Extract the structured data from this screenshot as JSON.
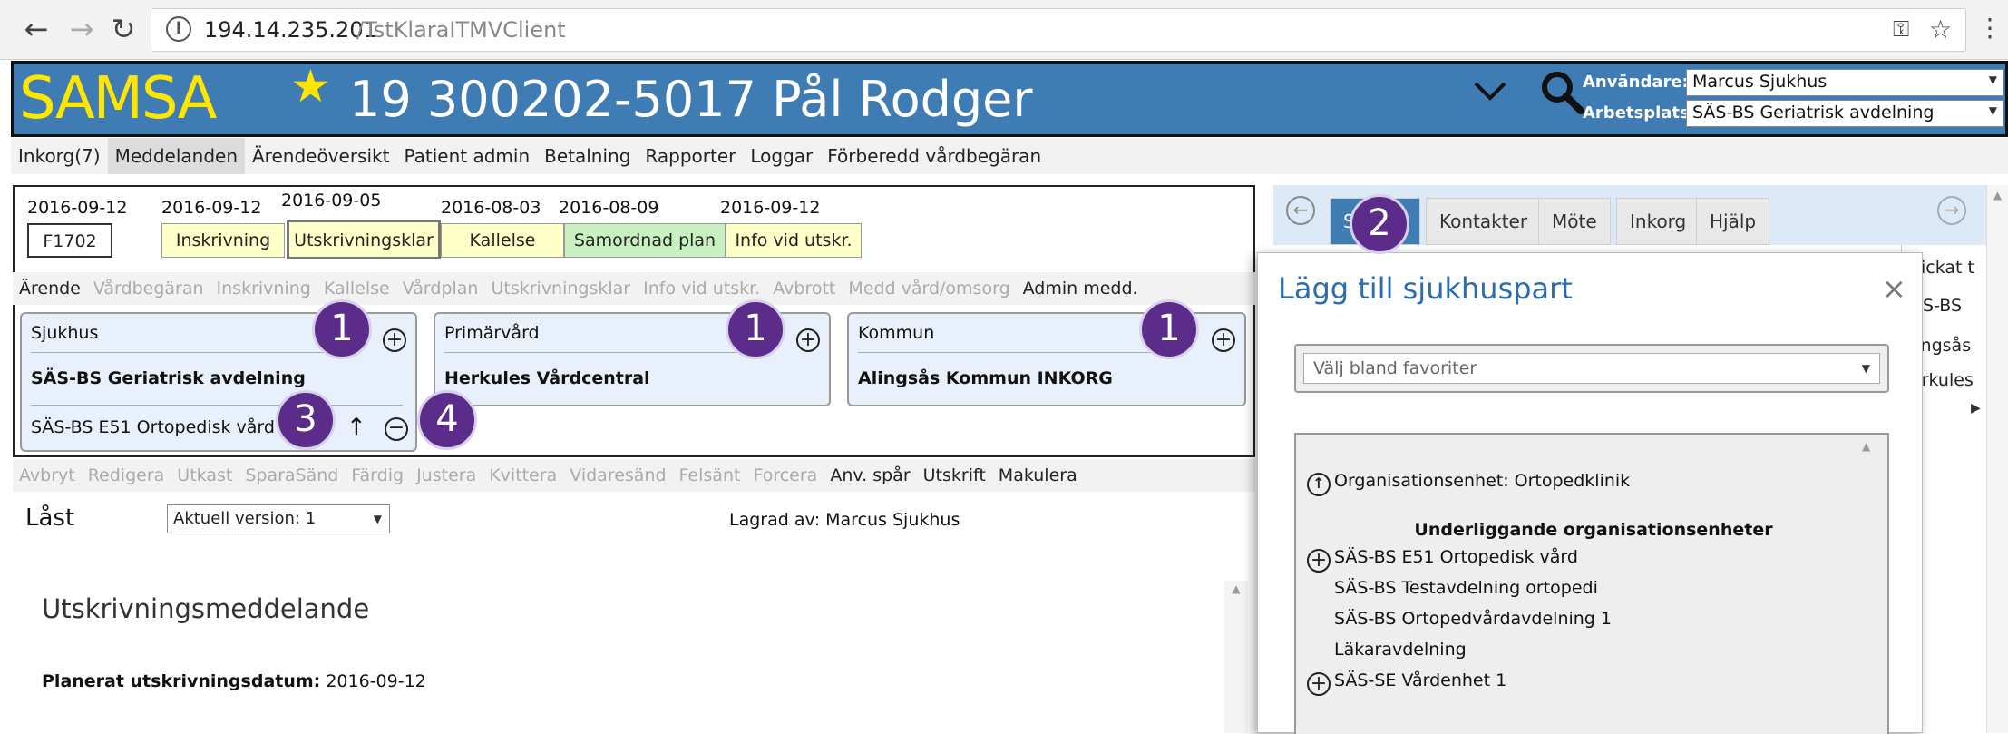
{
  "browser": {
    "url_host": "194.14.235.201",
    "url_path": "/TstKlaraITMVClient"
  },
  "header": {
    "logo": "SAMSA",
    "patient": "19 300202-5017 Pål Rodger",
    "user_label": "Användare:",
    "user_value": "Marcus Sjukhus",
    "workplace_label": "Arbetsplats:",
    "workplace_value": "SÄS-BS Geriatrisk avdelning"
  },
  "main_menu": [
    "Inkorg(7)",
    "Meddelanden",
    "Ärendeöversikt",
    "Patient admin",
    "Betalning",
    "Rapporter",
    "Loggar",
    "Förberedd vårdbegäran"
  ],
  "timeline": {
    "case_date": "2016-09-12",
    "case_id": "F1702",
    "stages": [
      {
        "date": "2016-09-12",
        "label": "Inskrivning",
        "color": "#ffffc8"
      },
      {
        "date": "2016-09-05",
        "label": "Utskrivningsklar",
        "color": "#ffffc8"
      },
      {
        "date": "2016-08-03",
        "label": "Kallelse",
        "color": "#ffffc8"
      },
      {
        "date": "2016-08-09",
        "label": "Samordnad plan",
        "color": "#c8f0c0"
      },
      {
        "date": "2016-09-12",
        "label": "Info vid utskr.",
        "color": "#ffffc8"
      }
    ]
  },
  "sub_menu": [
    "Ärende",
    "Vårdbegäran",
    "Inskrivning",
    "Kallelse",
    "Vårdplan",
    "Utskrivningsklar",
    "Info vid utskr.",
    "Avbrott",
    "Medd vård/omsorg",
    "Admin medd."
  ],
  "parties": [
    {
      "title": "Sjukhus",
      "unit": "SÄS-BS Geriatrisk avdelning",
      "extra": "SÄS-BS E51 Ortopedisk vård"
    },
    {
      "title": "Primärvård",
      "unit": "Herkules Vårdcentral"
    },
    {
      "title": "Kommun",
      "unit": "Alingsås Kommun INKORG"
    }
  ],
  "callouts": [
    "1",
    "1",
    "1",
    "2",
    "3",
    "4"
  ],
  "actions": [
    "Avbryt",
    "Redigera",
    "Utkast",
    "SparaSänd",
    "Färdig",
    "Justera",
    "Kvittera",
    "Vidaresänd",
    "Felsänt",
    "Forcera",
    "Anv. spår",
    "Utskrift",
    "Makulera"
  ],
  "status": {
    "state": "Låst",
    "version": "Aktuell version: 1",
    "saved_by": "Lagrad av: Marcus Sjukhus"
  },
  "content": {
    "heading": "Utskrivningsmeddelande",
    "planned_label": "Planerat utskrivningsdatum:",
    "planned_value": "2016-09-12"
  },
  "right_tabs": [
    "S",
    "Kontakter",
    "Möte",
    "Inkorg",
    "Hjälp"
  ],
  "right_table": [
    "kickat t",
    "ÄS-BS",
    "lingsås",
    "erkules"
  ],
  "modal": {
    "title": "Lägg till sjukhuspart",
    "favorites_placeholder": "Välj bland favoriter",
    "org_unit": "Organisationsenhet: Ortopedklinik",
    "sub_heading": "Underliggande organisationsenheter",
    "units": [
      {
        "label": "SÄS-BS E51 Ortopedisk vård",
        "expandable": true
      },
      {
        "label": "SÄS-BS Testavdelning ortopedi",
        "expandable": false
      },
      {
        "label": "SÄS-BS Ortopedvårdavdelning 1",
        "expandable": false
      },
      {
        "label": "Läkaravdelning",
        "expandable": false
      },
      {
        "label": "SÄS-SE Vårdenhet 1",
        "expandable": true
      }
    ]
  }
}
